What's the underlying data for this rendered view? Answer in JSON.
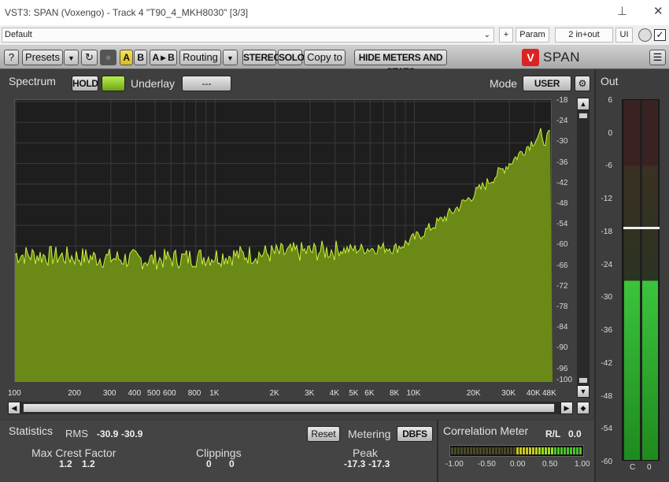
{
  "window": {
    "title": "VST3: SPAN (Voxengo) - Track 4 \"T90_4_MKH8030\" [3/3]"
  },
  "host": {
    "preset": "Default",
    "plus": "+",
    "param": "Param",
    "routing": "2 in+out",
    "ui": "UI"
  },
  "toolbar": {
    "help": "?",
    "presets": "Presets",
    "a": "A",
    "b": "B",
    "ab": "A ▸ B",
    "routing": "Routing",
    "stereo": "STEREO",
    "solo": "SOLO",
    "copy": "Copy to",
    "hide": "HIDE METERS AND STATS",
    "logo": "SPAN"
  },
  "spectrum": {
    "title": "Spectrum",
    "hold": "HOLD",
    "underlay": "Underlay",
    "underlay_value": "---",
    "mode_label": "Mode",
    "mode_value": "USER",
    "y_ticks": [
      "-18",
      "-24",
      "-30",
      "-36",
      "-42",
      "-48",
      "-54",
      "-60",
      "-66",
      "-72",
      "-78",
      "-84",
      "-90",
      "-96",
      "-100"
    ],
    "x_ticks": [
      "100",
      "200",
      "300",
      "400",
      "500",
      "600",
      "800",
      "1K",
      "2K",
      "3K",
      "4K",
      "5K",
      "6K",
      "8K",
      "10K",
      "20K",
      "30K",
      "40K",
      "48K"
    ]
  },
  "stats": {
    "title": "Statistics",
    "rms_label": "RMS",
    "rms_l": "-30.9",
    "rms_r": "-30.9",
    "reset": "Reset",
    "metering_label": "Metering",
    "metering_value": "DBFS",
    "crest_label": "Max Crest Factor",
    "crest_l": "1.2",
    "crest_r": "1.2",
    "clip_label": "Clippings",
    "clip_l": "0",
    "clip_r": "0",
    "peak_label": "Peak",
    "peak_l": "-17.3",
    "peak_r": "-17.3"
  },
  "corr": {
    "title": "Correlation Meter",
    "rl_label": "R/L",
    "rl_value": "0.0",
    "ticks": [
      "-1.00",
      "-0.50",
      "0.00",
      "0.50",
      "1.00"
    ]
  },
  "out": {
    "title": "Out",
    "ticks": [
      "6",
      "0",
      "-6",
      "-12",
      "-18",
      "-24",
      "-30",
      "-36",
      "-42",
      "-48",
      "-54",
      "-60"
    ],
    "ch_l": "C",
    "ch_r": "0",
    "level_db": -27,
    "peak_hold_db": -17.3
  },
  "colors": {
    "spectrum_fill": "#6b8a14",
    "spectrum_line": "#c5ee3a",
    "meter_green": "#3cc43c",
    "hold_led": "#8fdb2a"
  }
}
